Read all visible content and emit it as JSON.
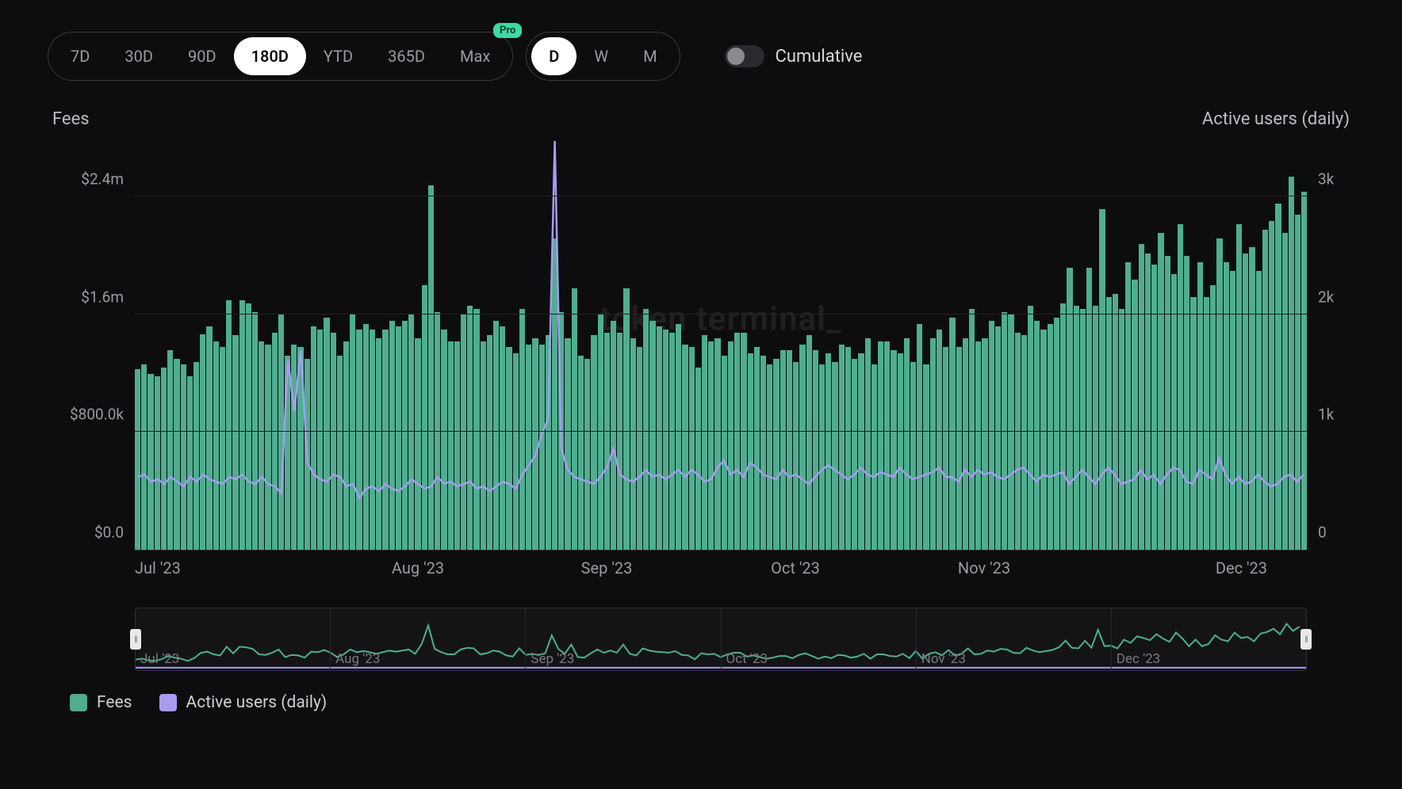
{
  "controls": {
    "ranges": [
      "7D",
      "30D",
      "90D",
      "180D",
      "YTD",
      "365D",
      "Max"
    ],
    "range_active": "180D",
    "pro_badge": "Pro",
    "granularity": [
      "D",
      "W",
      "M"
    ],
    "granularity_active": "D",
    "cumulative_label": "Cumulative",
    "cumulative_on": false
  },
  "axis_titles": {
    "left": "Fees",
    "right": "Active users (daily)"
  },
  "legend": [
    {
      "label": "Fees",
      "color": "#4fae8f"
    },
    {
      "label": "Active users (daily)",
      "color": "#a79cf2"
    }
  ],
  "watermark": "token terminal_",
  "colors": {
    "bar": "#4fae8f",
    "line": "#a79cf2",
    "brush_line": "#4fae8f"
  },
  "chart_data": {
    "type": "bar+line",
    "x_ticks": [
      "Jul '23",
      "Aug '23",
      "Sep '23",
      "Oct '23",
      "Nov '23",
      "Dec '23"
    ],
    "y_left": {
      "label": "Fees",
      "ticks": [
        "$0.0",
        "$800.0k",
        "$1.6m",
        "$2.4m"
      ],
      "min": 0,
      "max": 2800000
    },
    "y_right": {
      "label": "Active users (daily)",
      "ticks": [
        "0",
        "1k",
        "2k",
        "3k"
      ],
      "min": 0,
      "max": 3500
    },
    "series": [
      {
        "name": "Fees",
        "axis": "left",
        "type": "bar",
        "values": [
          1230000,
          1260000,
          1200000,
          1180000,
          1240000,
          1360000,
          1300000,
          1260000,
          1180000,
          1280000,
          1470000,
          1520000,
          1420000,
          1380000,
          1700000,
          1460000,
          1700000,
          1680000,
          1620000,
          1420000,
          1400000,
          1480000,
          1600000,
          1320000,
          1400000,
          1380000,
          1300000,
          1520000,
          1500000,
          1580000,
          1480000,
          1320000,
          1420000,
          1600000,
          1500000,
          1540000,
          1500000,
          1440000,
          1500000,
          1560000,
          1520000,
          1560000,
          1600000,
          1440000,
          1800000,
          2480000,
          1620000,
          1500000,
          1420000,
          1420000,
          1600000,
          1660000,
          1640000,
          1420000,
          1460000,
          1560000,
          1520000,
          1380000,
          1340000,
          1640000,
          1400000,
          1440000,
          1400000,
          1460000,
          2120000,
          1620000,
          1440000,
          1780000,
          1320000,
          1300000,
          1460000,
          1600000,
          1480000,
          1560000,
          1480000,
          1780000,
          1440000,
          1380000,
          1640000,
          1560000,
          1520000,
          1500000,
          1480000,
          1540000,
          1400000,
          1380000,
          1240000,
          1460000,
          1420000,
          1440000,
          1320000,
          1420000,
          1480000,
          1480000,
          1340000,
          1380000,
          1320000,
          1260000,
          1300000,
          1360000,
          1360000,
          1280000,
          1400000,
          1460000,
          1360000,
          1260000,
          1340000,
          1280000,
          1400000,
          1380000,
          1300000,
          1340000,
          1440000,
          1260000,
          1420000,
          1420000,
          1360000,
          1340000,
          1440000,
          1280000,
          1540000,
          1260000,
          1440000,
          1500000,
          1380000,
          1580000,
          1380000,
          1440000,
          1640000,
          1420000,
          1440000,
          1560000,
          1520000,
          1620000,
          1600000,
          1480000,
          1460000,
          1660000,
          1560000,
          1500000,
          1540000,
          1580000,
          1680000,
          1920000,
          1660000,
          1640000,
          1920000,
          1660000,
          2320000,
          1720000,
          1740000,
          1640000,
          1960000,
          1840000,
          2080000,
          2020000,
          1940000,
          2160000,
          2000000,
          1880000,
          2220000,
          2000000,
          1720000,
          1960000,
          1720000,
          1800000,
          2120000,
          1960000,
          1900000,
          2220000,
          2020000,
          2060000,
          1900000,
          2180000,
          2240000,
          2360000,
          2160000,
          2540000,
          2280000,
          2440000
        ]
      },
      {
        "name": "Active users (daily)",
        "axis": "right",
        "type": "line",
        "values": [
          620,
          640,
          580,
          600,
          560,
          620,
          580,
          540,
          620,
          580,
          640,
          600,
          580,
          560,
          620,
          600,
          640,
          580,
          560,
          620,
          560,
          540,
          480,
          1620,
          1180,
          1700,
          740,
          640,
          600,
          580,
          640,
          620,
          540,
          560,
          440,
          520,
          540,
          500,
          560,
          520,
          500,
          540,
          600,
          560,
          520,
          540,
          620,
          560,
          580,
          540,
          560,
          580,
          520,
          540,
          500,
          540,
          580,
          560,
          520,
          640,
          720,
          800,
          980,
          1120,
          3480,
          860,
          680,
          620,
          600,
          580,
          560,
          620,
          700,
          860,
          640,
          600,
          580,
          620,
          680,
          620,
          640,
          600,
          640,
          680,
          620,
          680,
          640,
          580,
          600,
          700,
          760,
          640,
          680,
          620,
          740,
          700,
          640,
          620,
          600,
          680,
          620,
          640,
          600,
          560,
          620,
          680,
          720,
          680,
          640,
          600,
          640,
          700,
          640,
          620,
          660,
          640,
          620,
          700,
          640,
          600,
          620,
          640,
          660,
          700,
          620,
          620,
          580,
          680,
          620,
          680,
          640,
          660,
          620,
          600,
          640,
          680,
          700,
          640,
          580,
          640,
          620,
          640,
          660,
          560,
          620,
          680,
          620,
          560,
          640,
          700,
          640,
          560,
          580,
          600,
          680,
          600,
          640,
          560,
          640,
          700,
          680,
          580,
          560,
          680,
          640,
          600,
          780,
          640,
          560,
          620,
          560,
          580,
          640,
          580,
          540,
          560,
          620,
          640,
          580,
          640
        ]
      }
    ]
  },
  "brush": {
    "ticks": [
      "Jul '23",
      "Aug '23",
      "Sep '23",
      "Oct '23",
      "Nov '23",
      "Dec '23"
    ]
  }
}
